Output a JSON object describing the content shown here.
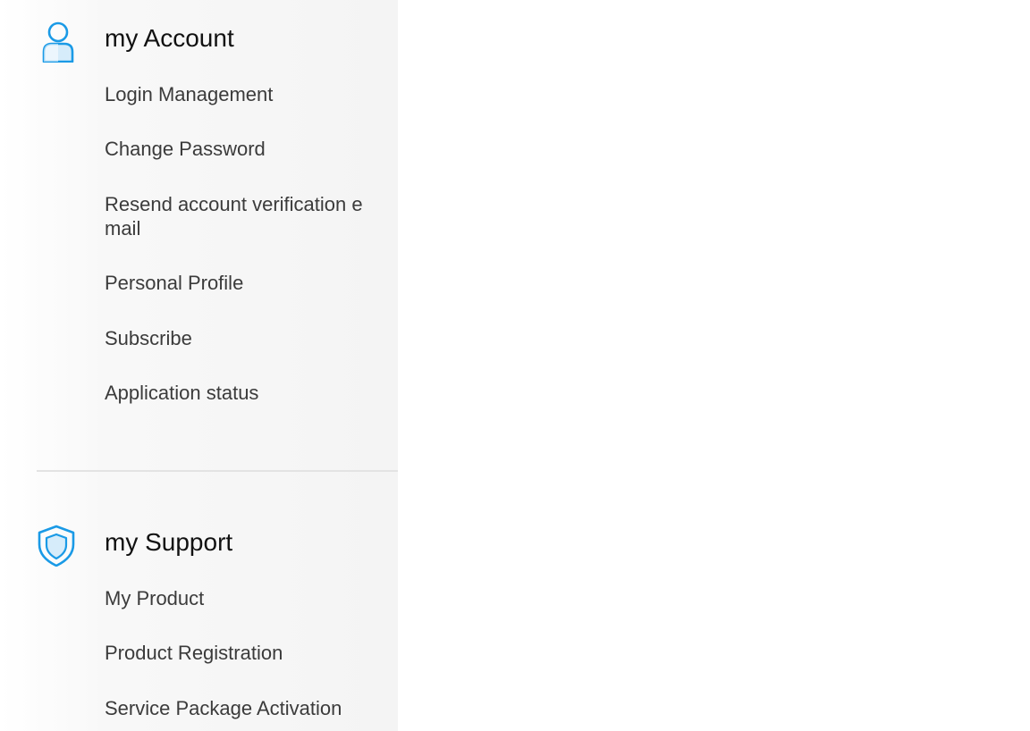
{
  "account": {
    "title": "my Account",
    "icon": "user-icon",
    "items": [
      {
        "label": "Login Management"
      },
      {
        "label": "Change Password"
      },
      {
        "label": "Resend account verification e mail"
      },
      {
        "label": "Personal Profile"
      },
      {
        "label": "Subscribe"
      },
      {
        "label": "Application status"
      }
    ]
  },
  "support": {
    "title": "my Support",
    "icon": "shield-icon",
    "items": [
      {
        "label": "My Product"
      },
      {
        "label": "Product Registration"
      },
      {
        "label": "Service Package Activation"
      }
    ]
  },
  "colors": {
    "accent": "#1a9ae6",
    "sidebar_bg": "#f4f4f4",
    "title_text": "#111111",
    "link_text": "#3b3b3b",
    "divider": "#e3e3e3"
  }
}
